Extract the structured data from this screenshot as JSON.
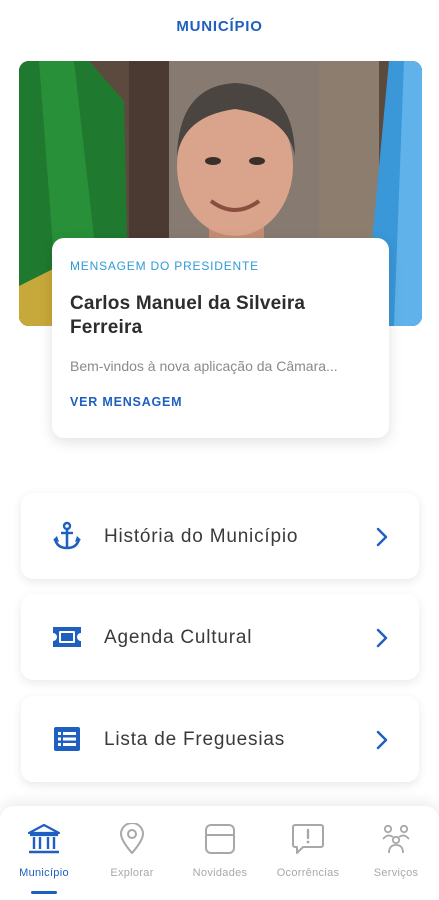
{
  "header": {
    "title": "MUNICÍPIO"
  },
  "president_message": {
    "kicker": "MENSAGEM DO PRESIDENTE",
    "name": "Carlos Manuel da Silveira Ferreira",
    "excerpt": "Bem-vindos à nova aplicação da Câmara...",
    "cta": "VER MENSAGEM"
  },
  "menu": [
    {
      "label": "História do Município",
      "icon": "anchor-icon"
    },
    {
      "label": "Agenda Cultural",
      "icon": "ticket-icon"
    },
    {
      "label": "Lista de Freguesias",
      "icon": "list-icon"
    }
  ],
  "bottom_nav": [
    {
      "label": "Município",
      "icon": "bank-icon",
      "active": true
    },
    {
      "label": "Explorar",
      "icon": "location-pin-icon",
      "active": false
    },
    {
      "label": "Novidades",
      "icon": "news-icon",
      "active": false
    },
    {
      "label": "Ocorrências",
      "icon": "alert-chat-icon",
      "active": false
    },
    {
      "label": "Serviços",
      "icon": "people-network-icon",
      "active": false
    }
  ],
  "colors": {
    "primary": "#1f5fbf",
    "accent": "#2e9bd6",
    "inactive": "#a8a8a8"
  }
}
